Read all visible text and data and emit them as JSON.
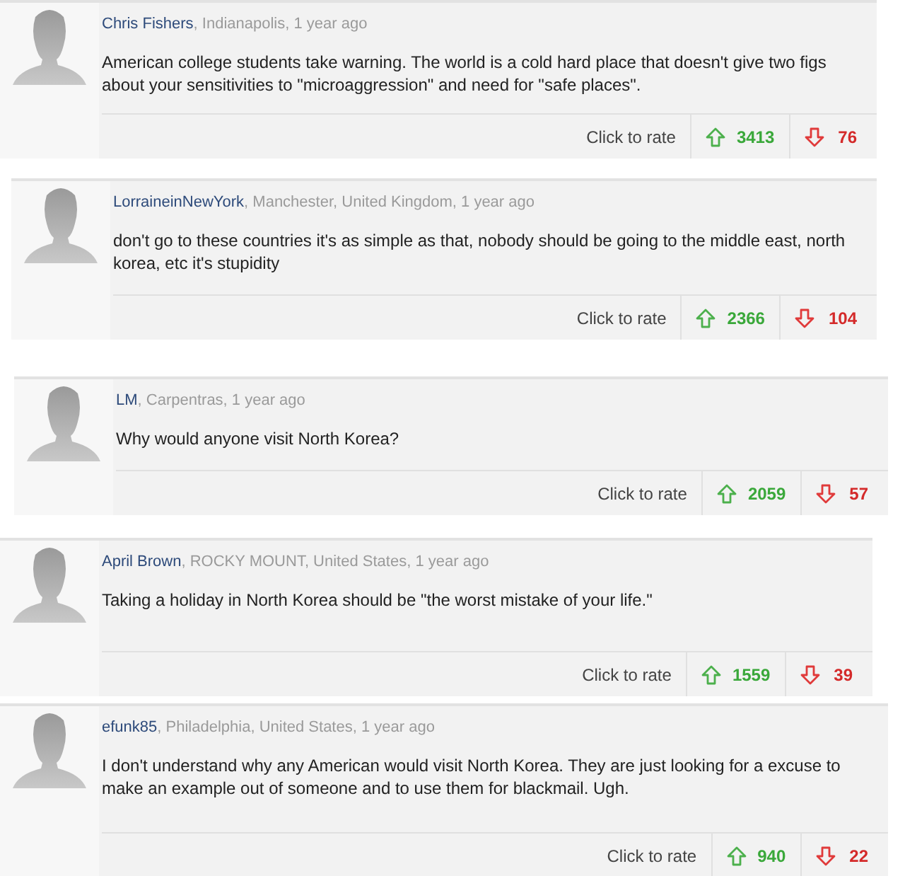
{
  "comments": [
    {
      "author": "Chris Fishers",
      "meta": ", Indianapolis, 1 year ago",
      "text": "American college students take warning. The world is a cold hard place that doesn't give two figs about your sensitivities to \"microaggression\" and need for \"safe places\".",
      "rate_label": "Click to rate",
      "up": "3413",
      "down": "76"
    },
    {
      "author": "LorraineinNewYork",
      "meta": ", Manchester, United Kingdom, 1 year ago",
      "text": "don't go to these countries it's as simple as that, nobody should be going to the middle east, north korea, etc it's stupidity",
      "rate_label": "Click to rate",
      "up": "2366",
      "down": "104"
    },
    {
      "author": "LM",
      "meta": ", Carpentras, 1 year ago",
      "text": "Why would anyone visit North Korea?",
      "rate_label": "Click to rate",
      "up": "2059",
      "down": "57"
    },
    {
      "author": "April Brown",
      "meta": ", ROCKY MOUNT, United States, 1 year ago",
      "text": "Taking a holiday in North Korea should be \"the worst mistake of your life.\"",
      "rate_label": "Click to rate",
      "up": "1559",
      "down": "39"
    },
    {
      "author": "efunk85",
      "meta": ", Philadelphia, United States, 1 year ago",
      "text": "I don't understand why any American would visit North Korea. They are just looking for a excuse to make an example out of someone and to use them for blackmail. Ugh.",
      "rate_label": "Click to rate",
      "up": "940",
      "down": "22"
    }
  ]
}
